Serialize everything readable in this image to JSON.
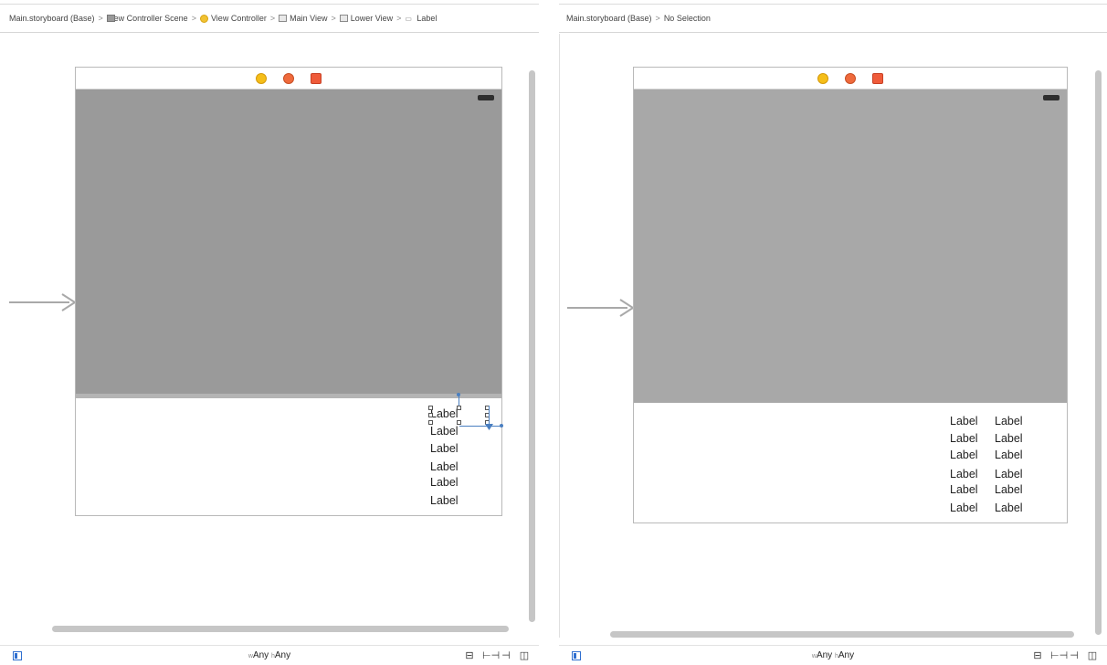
{
  "left_panel": {
    "breadcrumb": [
      {
        "icon": "storyboard-file-icon",
        "label": "Main.storyboard (Base)"
      },
      {
        "icon": "scene-icon",
        "label": "View Controller Scene"
      },
      {
        "icon": "view-controller-icon",
        "label": "View Controller"
      },
      {
        "icon": "view-icon",
        "label": "Main View"
      },
      {
        "icon": "view-icon",
        "label": "Lower View"
      },
      {
        "icon": "label-icon",
        "label": "Label"
      }
    ],
    "labels_col1": [
      "Label",
      "Label",
      "Label",
      "Label",
      "Label",
      "Label"
    ],
    "size_class": {
      "w_prefix": "w",
      "w_value": "Any",
      "h_prefix": "h",
      "h_value": "Any"
    }
  },
  "right_panel": {
    "breadcrumb": [
      {
        "label": "Main.storyboard (Base)"
      },
      {
        "label": "No Selection"
      }
    ],
    "labels_col1": [
      "Label",
      "Label",
      "Label",
      "Label",
      "Label",
      "Label"
    ],
    "labels_col2": [
      "Label",
      "Label",
      "Label",
      "Label",
      "Label",
      "Label"
    ],
    "size_class": {
      "w_prefix": "w",
      "w_value": "Any",
      "h_prefix": "h",
      "h_value": "Any"
    }
  },
  "colors": {
    "upper_view_left": "#9a9a9a",
    "upper_view_right": "#a8a8a8",
    "selection_blue": "#4a7fc1"
  },
  "layout_tools": [
    "align-icon",
    "pin-icon",
    "resolve-icon",
    "resize-icon"
  ],
  "separator": ">"
}
